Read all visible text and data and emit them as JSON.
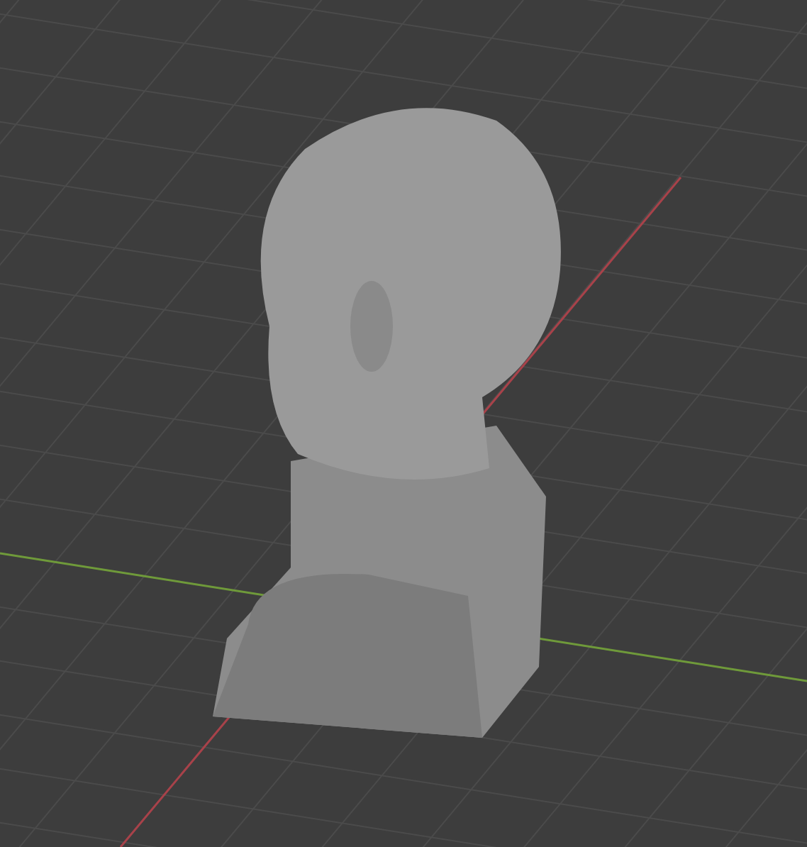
{
  "viewport": {
    "show_x_axis": true,
    "show_y_axis": true
  }
}
